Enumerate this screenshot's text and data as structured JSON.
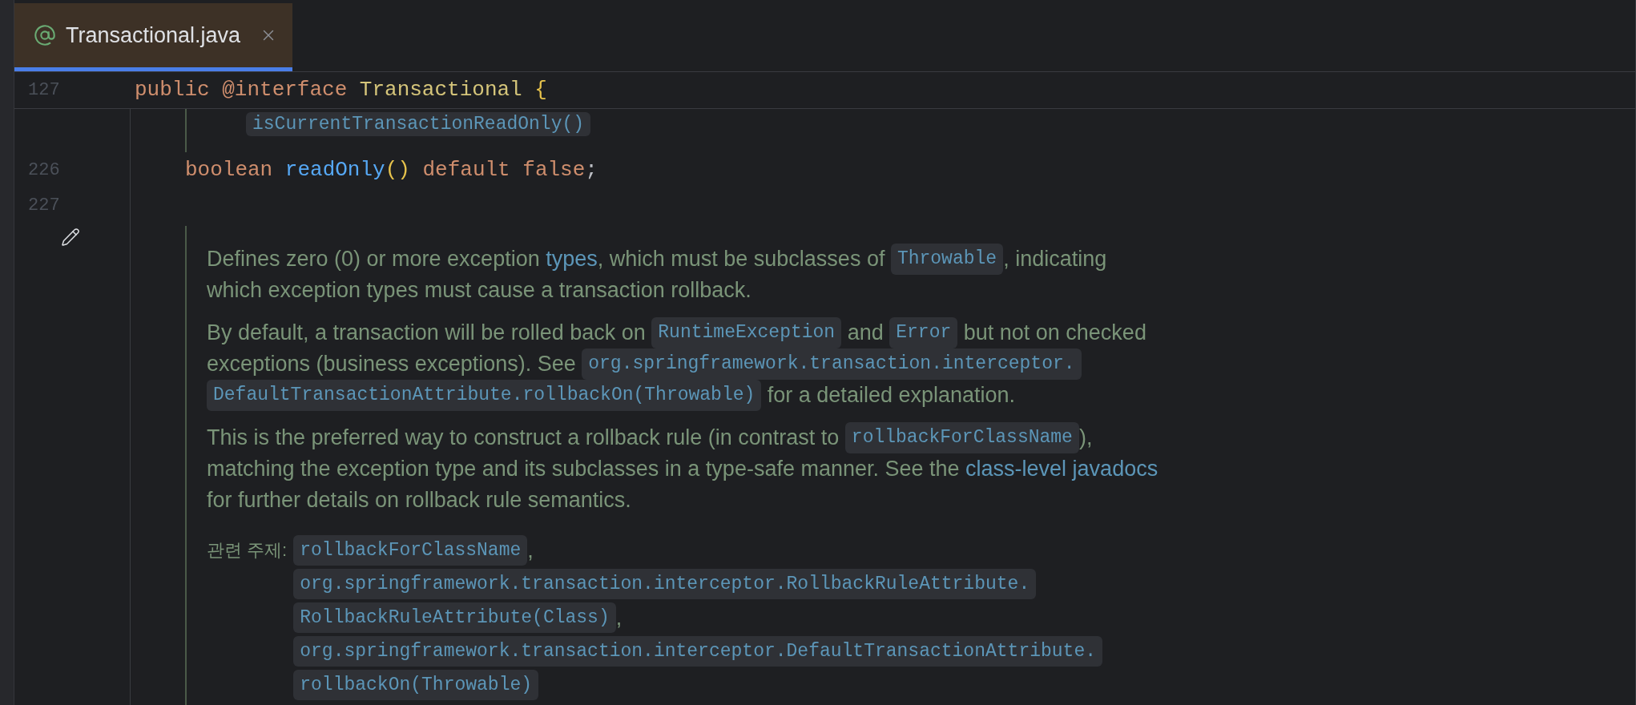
{
  "tab": {
    "title": "Transactional.java",
    "selected": true
  },
  "sticky_line": {
    "number": "127",
    "tokens": [
      {
        "kind": "keyword",
        "text": "public "
      },
      {
        "kind": "annotation",
        "text": "@interface "
      },
      {
        "kind": "class",
        "text": "Transactional "
      },
      {
        "kind": "brace",
        "text": "{"
      }
    ]
  },
  "folded_hint": "isCurrentTransactionReadOnly()",
  "lines": [
    {
      "number": "226",
      "tokens": [
        {
          "kind": "keyword",
          "text": "boolean "
        },
        {
          "kind": "method",
          "text": "readOnly"
        },
        {
          "kind": "brace",
          "text": "() "
        },
        {
          "kind": "keyword",
          "text": "default false"
        },
        {
          "kind": "plain",
          "text": ";"
        }
      ]
    },
    {
      "number": "227"
    }
  ],
  "doc": {
    "paragraphs": [
      [
        [
          {
            "kind": "text",
            "text": "Defines zero (0) or more exception "
          },
          {
            "kind": "link",
            "text": "types"
          },
          {
            "kind": "text",
            "text": ", which must be subclasses of "
          },
          {
            "kind": "code",
            "text": "Throwable"
          },
          {
            "kind": "text",
            "text": ", indicating"
          }
        ],
        [
          {
            "kind": "text",
            "text": "which exception types must cause a transaction rollback."
          }
        ]
      ],
      [
        [
          {
            "kind": "text",
            "text": "By default, a transaction will be rolled back on "
          },
          {
            "kind": "code",
            "text": "RuntimeException"
          },
          {
            "kind": "text",
            "text": " and "
          },
          {
            "kind": "code",
            "text": "Error"
          },
          {
            "kind": "text",
            "text": " but not on checked"
          }
        ],
        [
          {
            "kind": "text",
            "text": "exceptions (business exceptions). See "
          },
          {
            "kind": "code",
            "text": "org.springframework.transaction.interceptor."
          }
        ],
        [
          {
            "kind": "code",
            "text": "DefaultTransactionAttribute.rollbackOn(Throwable)"
          },
          {
            "kind": "text",
            "text": " for a detailed explanation."
          }
        ]
      ],
      [
        [
          {
            "kind": "text",
            "text": "This is the preferred way to construct a rollback rule (in contrast to "
          },
          {
            "kind": "code",
            "text": "rollbackForClassName"
          },
          {
            "kind": "text",
            "text": "),"
          }
        ],
        [
          {
            "kind": "text",
            "text": "matching the exception type and its subclasses in a type-safe manner. See the "
          },
          {
            "kind": "link",
            "text": "class-level javadocs"
          }
        ],
        [
          {
            "kind": "text",
            "text": "for further details on rollback rule semantics."
          }
        ]
      ]
    ]
  },
  "see_also": {
    "label": "관련 주제:",
    "items": [
      {
        "text": "rollbackForClassName",
        "suffix": ","
      },
      {
        "text": "org.springframework.transaction.interceptor.RollbackRuleAttribute."
      },
      {
        "text": "RollbackRuleAttribute(Class)",
        "suffix": ","
      },
      {
        "text": "org.springframework.transaction.interceptor.DefaultTransactionAttribute."
      },
      {
        "text": "rollbackOn(Throwable)"
      }
    ]
  }
}
